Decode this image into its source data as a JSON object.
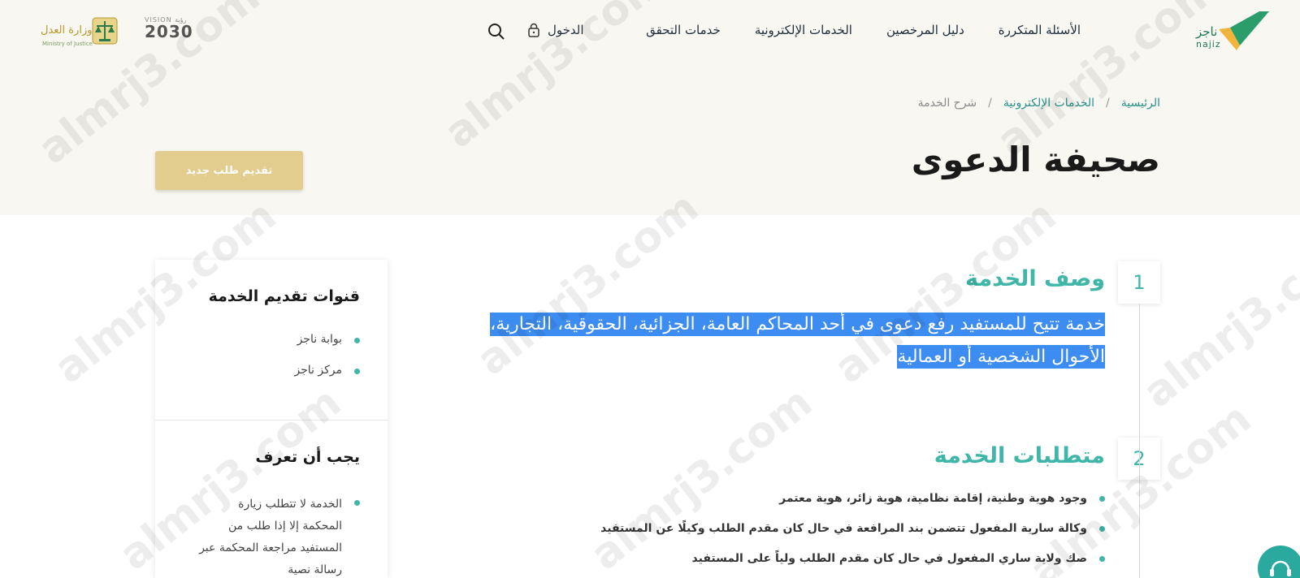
{
  "header": {
    "logo_ar": "ناجز",
    "logo_en": "najiz",
    "nav": [
      {
        "label": "خدمات التحقق"
      },
      {
        "label": "الخدمات الإلكترونية"
      },
      {
        "label": "دليل المرخصين"
      },
      {
        "label": "الأسئلة المتكررة"
      }
    ],
    "login_label": "الدخول",
    "vision_top": "VISION رؤية",
    "vision_year": "2030",
    "moj_ar": "وزارة العدل",
    "moj_en": "Ministry of Justice"
  },
  "breadcrumb": {
    "home": "الرئيسية",
    "sep": "/",
    "section": "الخدمات الإلكترونية",
    "current": "شرح الخدمة"
  },
  "page": {
    "title": "صحيفة الدعوى",
    "new_request_label": "تقديم طلب جديد"
  },
  "sections": {
    "s1": {
      "number": "1",
      "title": "وصف الخدمة",
      "line1": "خدمة تتيح للمستفيد رفع دعوى في أحد المحاكم العامة، الجزائية، الحقوقية، التجارية،",
      "line2": "الأحوال الشخصية أو العمالية"
    },
    "s2": {
      "number": "2",
      "title": "متطلبات الخدمة",
      "items": [
        "وجود هوية وطنية، إقامة نظامية، هوية زائر، هوية معتمر",
        "وكالة سارية المفعول تتضمن بند المرافعة في حال كان مقدم الطلب وكيلًا عن المستفيد",
        "صك ولاية ساري المفعول في حال كان مقدم الطلب ولياً على المستفيد"
      ]
    }
  },
  "side": {
    "channels_title": "قنوات تقديم الخدمة",
    "channels": [
      "بوابة ناجز",
      "مركز ناجز"
    ],
    "know_title": "يجب أن تعرف",
    "know_text": "الخدمة لا تتطلب زيارة المحكمة إلا إذا طلب من المستفيد مراجعة المحكمة عبر رسالة نصية"
  },
  "watermark": "almrj3.com",
  "colors": {
    "accent": "#3fb6a8",
    "gold_button": "#e2cc8e",
    "selection": "#3c8cf1",
    "header_bg": "#f8f7f2"
  }
}
